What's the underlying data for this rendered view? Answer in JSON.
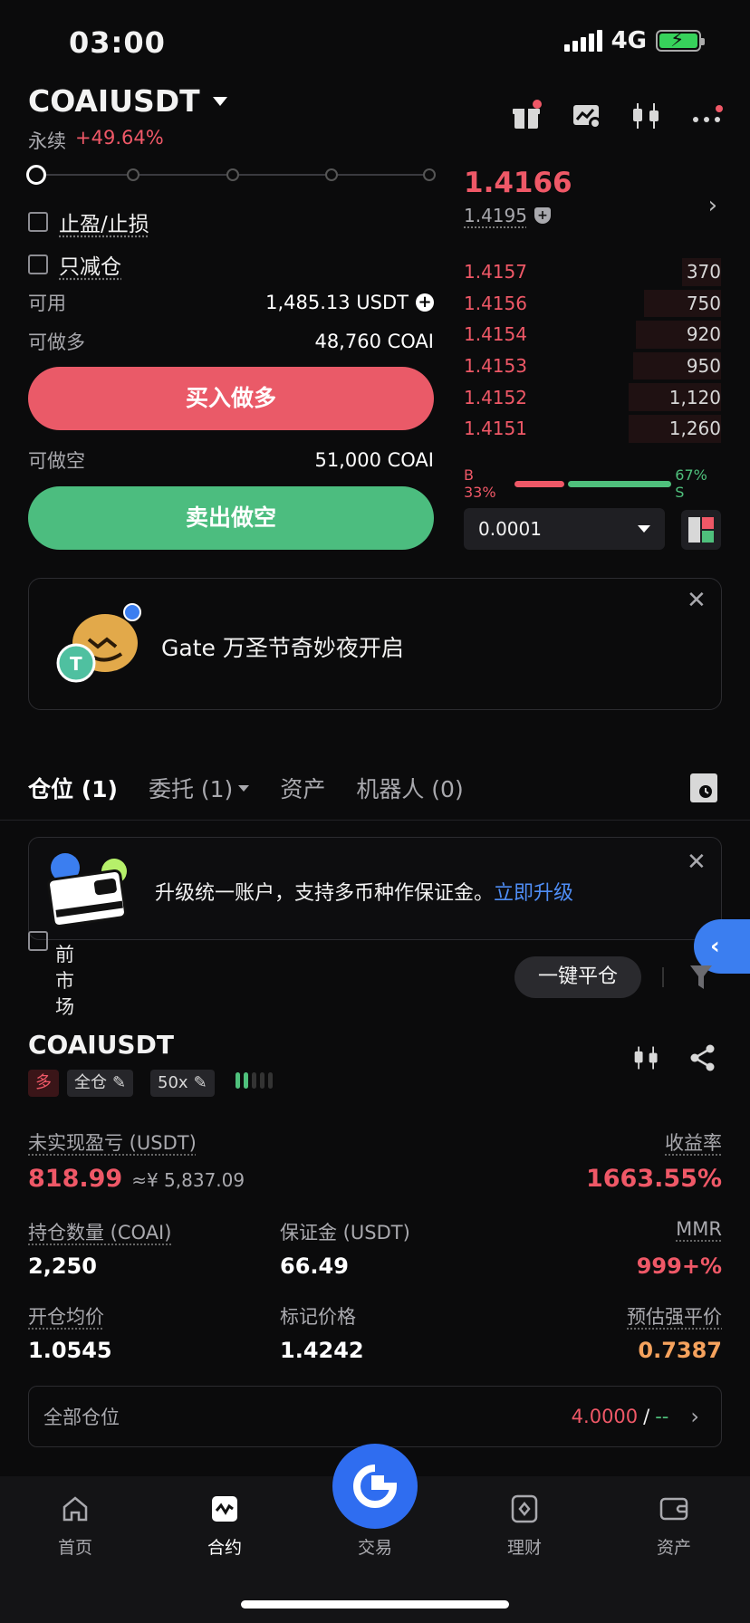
{
  "status": {
    "time": "03:00",
    "network": "4G"
  },
  "header": {
    "symbol": "COAIUSDT",
    "contract_type": "永续",
    "change": "+49.64%"
  },
  "form": {
    "tp_sl_label": "止盈/止损",
    "reduce_only_label": "只减仓",
    "available_label": "可用",
    "available_value": "1,485.13 USDT",
    "can_long_label": "可做多",
    "can_long_value": "48,760 COAI",
    "buy_button": "买入做多",
    "can_short_label": "可做空",
    "can_short_value": "51,000 COAI",
    "sell_button": "卖出做空"
  },
  "orderbook": {
    "last_price": "1.4166",
    "mark_price": "1.4195",
    "asks": [
      {
        "price": "1.4157",
        "qty": "370",
        "depth": 0.15
      },
      {
        "price": "1.4156",
        "qty": "750",
        "depth": 0.3
      },
      {
        "price": "1.4154",
        "qty": "920",
        "depth": 0.33
      },
      {
        "price": "1.4153",
        "qty": "950",
        "depth": 0.34
      },
      {
        "price": "1.4152",
        "qty": "1,120",
        "depth": 0.36
      },
      {
        "price": "1.4151",
        "qty": "1,260",
        "depth": 0.36
      }
    ],
    "buy_ratio_label": "B 33%",
    "buy_ratio": 0.33,
    "sell_ratio_label": "67% S",
    "sell_ratio": 0.67,
    "precision": "0.0001"
  },
  "promo": {
    "text": "Gate 万圣节奇妙夜开启"
  },
  "tabs": [
    {
      "label": "仓位 (1)"
    },
    {
      "label": "委托 (1)"
    },
    {
      "label": "资产"
    },
    {
      "label": "机器人 (0)"
    }
  ],
  "upgrade": {
    "text": "升级统一账户，支持多币种作保证金。",
    "link": "立即升级"
  },
  "filter": {
    "vertical_text": "前市场",
    "close_all": "一键平仓"
  },
  "position": {
    "symbol": "COAIUSDT",
    "side": "多",
    "margin_mode": "全仓",
    "leverage": "50x",
    "leverage_level": 2,
    "upnl_label": "未实现盈亏 (USDT)",
    "upnl_value": "818.99",
    "upnl_cny": "≈¥ 5,837.09",
    "roe_label": "收益率",
    "roe_value": "1663.55%",
    "size_label": "持仓数量 (COAI)",
    "size_value": "2,250",
    "margin_label": "保证金 (USDT)",
    "margin_value": "66.49",
    "mmr_label": "MMR",
    "mmr_value": "999+%",
    "entry_label": "开仓均价",
    "entry_value": "1.0545",
    "mark_label": "标记价格",
    "mark_value": "1.4242",
    "liq_label": "预估强平价",
    "liq_value": "0.7387"
  },
  "all_positions": {
    "label": "全部仓位",
    "value": "4.0000",
    "sep": "/",
    "value2": "--"
  },
  "nav": [
    {
      "label": "首页",
      "icon": "home-icon"
    },
    {
      "label": "合约",
      "icon": "futures-icon"
    },
    {
      "label": "交易",
      "icon": "gate-logo-icon"
    },
    {
      "label": "理财",
      "icon": "finance-icon"
    },
    {
      "label": "资产",
      "icon": "wallet-icon"
    }
  ],
  "colors": {
    "red": "#ef5867",
    "green": "#4fc07c",
    "accent": "#3b7ef0",
    "orange": "#f5a25d"
  }
}
